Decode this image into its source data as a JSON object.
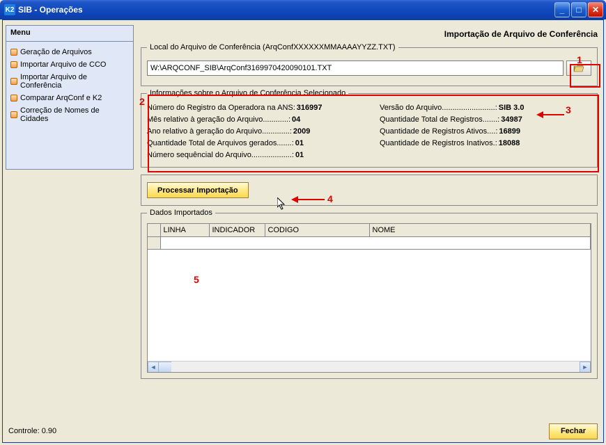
{
  "window": {
    "title": "SIB - Operações",
    "app_icon_text": "K2"
  },
  "menu": {
    "title": "Menu",
    "items": [
      "Geração de Arquivos",
      "Importar Arquivo de CCO",
      "Importar Arquivo de Conferência",
      "Comparar ArqConf e K2",
      "Correção de Nomes de Cidades"
    ]
  },
  "page_title": "Importação de Arquivo de Conferência",
  "file_section": {
    "legend": "Local do Arquivo de Conferência (ArqConfXXXXXXMMAAAAYYZZ.TXT)",
    "path": "W:\\ARQCONF_SIB\\ArqConf3169970420090101.TXT"
  },
  "info_section": {
    "legend": "Informações sobre o Arquivo de Conferência Selecionado",
    "left": [
      {
        "label": "Número do Registro da Operadora na ANS:",
        "value": "316997"
      },
      {
        "label": "Mês relativo à geração do Arquivo............:",
        "value": "04"
      },
      {
        "label": "Ano relativo à geração do Arquivo.............:",
        "value": "2009"
      },
      {
        "label": "Quantidade Total de Arquivos gerados.......:",
        "value": "01"
      },
      {
        "label": "Número sequêncial do Arquivo...................:",
        "value": "01"
      }
    ],
    "right": [
      {
        "label": "Versão do Arquivo.........................:",
        "value": "SIB 3.0"
      },
      {
        "label": "Quantidade Total de Registros.......:",
        "value": "34987"
      },
      {
        "label": "Quantidade de Registros Ativos....:",
        "value": "16899"
      },
      {
        "label": "Quantidade de Registros Inativos.:",
        "value": "18088"
      }
    ]
  },
  "process_button": "Processar Importação",
  "data_section": {
    "legend": "Dados Importados",
    "columns": [
      "LINHA",
      "INDICADOR",
      "CODIGO",
      "NOME"
    ]
  },
  "footer": {
    "controle": "Controle: 0.90",
    "close": "Fechar"
  },
  "annotations": {
    "1": "1",
    "2": "2",
    "3": "3",
    "4": "4",
    "5": "5"
  }
}
